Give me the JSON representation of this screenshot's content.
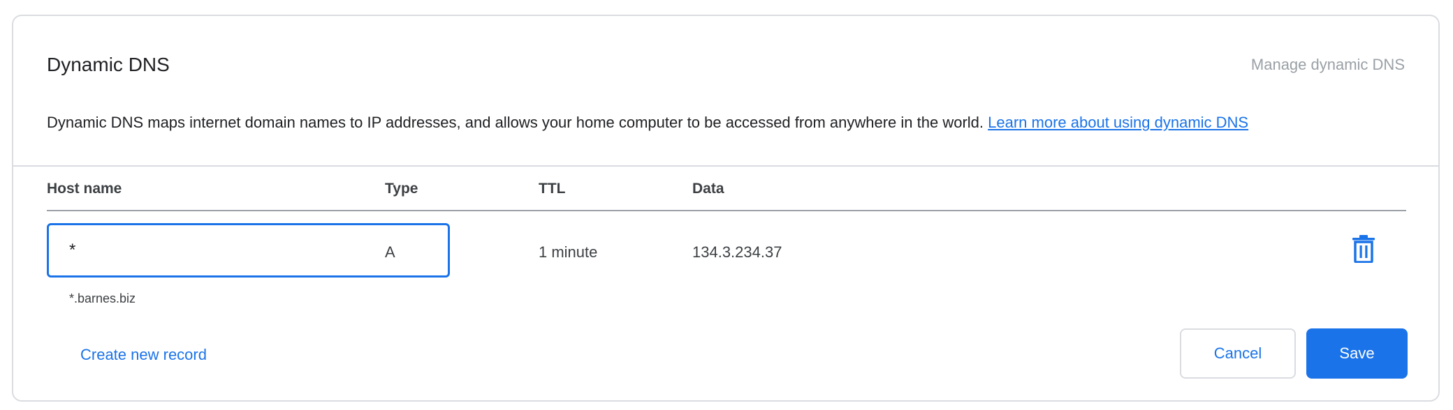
{
  "section": {
    "title": "Dynamic DNS",
    "manage_link": "Manage dynamic DNS",
    "description": "Dynamic DNS maps internet domain names to IP addresses, and allows your home computer to be accessed from anywhere in the world.",
    "learn_more_link": "Learn more about using dynamic DNS"
  },
  "table": {
    "headers": {
      "host_name": "Host name",
      "type": "Type",
      "ttl": "TTL",
      "data": "Data"
    },
    "row": {
      "host_value": "*",
      "host_hint": "*.barnes.biz",
      "type": "A",
      "ttl": "1 minute",
      "data": "134.3.234.37",
      "delete_icon": "trash-icon"
    }
  },
  "footer": {
    "create_label": "Create new record",
    "cancel_label": "Cancel",
    "save_label": "Save"
  },
  "colors": {
    "accent": "#1a73e8",
    "border": "#dadce0",
    "muted": "#9aa0a6"
  }
}
